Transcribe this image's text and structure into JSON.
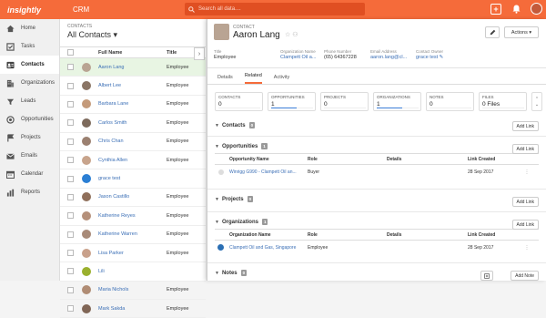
{
  "app": {
    "logo": "insightly",
    "title": "CRM"
  },
  "search": {
    "placeholder": "Search all data...."
  },
  "sidebar": {
    "items": [
      {
        "label": "Home",
        "icon": "home-icon"
      },
      {
        "label": "Tasks",
        "icon": "tasks-icon"
      },
      {
        "label": "Contacts",
        "icon": "contacts-icon",
        "active": true
      },
      {
        "label": "Organizations",
        "icon": "organizations-icon"
      },
      {
        "label": "Leads",
        "icon": "leads-icon"
      },
      {
        "label": "Opportunities",
        "icon": "opportunities-icon"
      },
      {
        "label": "Projects",
        "icon": "projects-icon"
      },
      {
        "label": "Emails",
        "icon": "emails-icon"
      },
      {
        "label": "Calendar",
        "icon": "calendar-icon"
      },
      {
        "label": "Reports",
        "icon": "reports-icon"
      }
    ]
  },
  "list": {
    "section_label": "CONTACTS",
    "view_title": "All Contacts ▾",
    "col_name": "Full Name",
    "col_title": "Title",
    "rows": [
      {
        "name": "Aaron Lang",
        "title": "Employee",
        "avatar": "#b9a493"
      },
      {
        "name": "Albert Lee",
        "title": "Employee",
        "avatar": "#8a7565"
      },
      {
        "name": "Barbara Lane",
        "title": "Employee",
        "avatar": "#c49a7a"
      },
      {
        "name": "Carlos Smith",
        "title": "Employee",
        "avatar": "#7d6a5c"
      },
      {
        "name": "Chris Chan",
        "title": "Employee",
        "avatar": "#9b8070"
      },
      {
        "name": "Cynthia Allen",
        "title": "Employee",
        "avatar": "#c8a48c"
      },
      {
        "name": "grace test",
        "title": "",
        "avatar": "#2b7fd4"
      },
      {
        "name": "Jason Castillo",
        "title": "Employee",
        "avatar": "#8f6f5a"
      },
      {
        "name": "Katherine Reyes",
        "title": "Employee",
        "avatar": "#b5907a"
      },
      {
        "name": "Katherine Warren",
        "title": "Employee",
        "avatar": "#a88a78"
      },
      {
        "name": "Lisa Parker",
        "title": "Employee",
        "avatar": "#c9a18b"
      },
      {
        "name": "Lili",
        "title": "",
        "avatar": "#9ab02e"
      },
      {
        "name": "Maria Nichols",
        "title": "Employee",
        "avatar": "#b08c74"
      },
      {
        "name": "Mark Sakda",
        "title": "Employee",
        "avatar": "#806656"
      }
    ]
  },
  "panel": {
    "kind": "CONTACT",
    "name": "Aaron Lang",
    "actions_label": "Actions ▾",
    "fields": [
      {
        "label": "Title",
        "value": "Employee",
        "link": false
      },
      {
        "label": "Organization Name",
        "value": "Clampett Oil a...",
        "link": true
      },
      {
        "label": "Phone Number",
        "value": "(65) 64367228",
        "link": false
      },
      {
        "label": "Email Address",
        "value": "aaron.lang@cl...",
        "link": true
      },
      {
        "label": "Contact Owner",
        "value": "grace test ✎",
        "link": true
      }
    ],
    "tabs": [
      {
        "label": "Details",
        "active": false
      },
      {
        "label": "Related",
        "active": true
      },
      {
        "label": "Activity",
        "active": false
      }
    ],
    "counters": [
      {
        "label": "CONTACTS",
        "value": "0",
        "fill": 0
      },
      {
        "label": "OPPORTUNITIES",
        "value": "1",
        "fill": 0.6
      },
      {
        "label": "PROJECTS",
        "value": "0",
        "fill": 0
      },
      {
        "label": "ORGANIZATIONS",
        "value": "1",
        "fill": 0.6
      },
      {
        "label": "NOTES",
        "value": "0",
        "fill": 0
      },
      {
        "label": "FILES",
        "value": "0 Files",
        "fill": 0
      }
    ],
    "sections": {
      "contacts": {
        "title": "Contacts",
        "count": "0",
        "button": "Add Link"
      },
      "opportunities": {
        "title": "Opportunities",
        "count": "1",
        "button": "Add Link",
        "headers": [
          "",
          "Opportunity Name",
          "Role",
          "Details",
          "Link Created",
          ""
        ],
        "row": {
          "name": "Winrigg G990 - Clampett Oil an...",
          "role": "Buyer",
          "details": "",
          "created": "28 Sep 2017",
          "menu": "⋮"
        }
      },
      "projects": {
        "title": "Projects",
        "count": "0",
        "button": "Add Link"
      },
      "organizations": {
        "title": "Organizations",
        "count": "1",
        "button": "Add Link",
        "headers": [
          "",
          "Organization Name",
          "Role",
          "Details",
          "Link Created",
          ""
        ],
        "row": {
          "name": "Clampett Oil and Gas, Singapore",
          "role": "Employee",
          "details": "",
          "created": "28 Sep 2017",
          "menu": "⋮"
        }
      },
      "notes": {
        "title": "Notes",
        "count": "0",
        "button": "Add Note"
      }
    }
  },
  "colors": {
    "brand": "#f56b3a",
    "link": "#3b6fb6",
    "selected_row": "#e8f5e3"
  }
}
